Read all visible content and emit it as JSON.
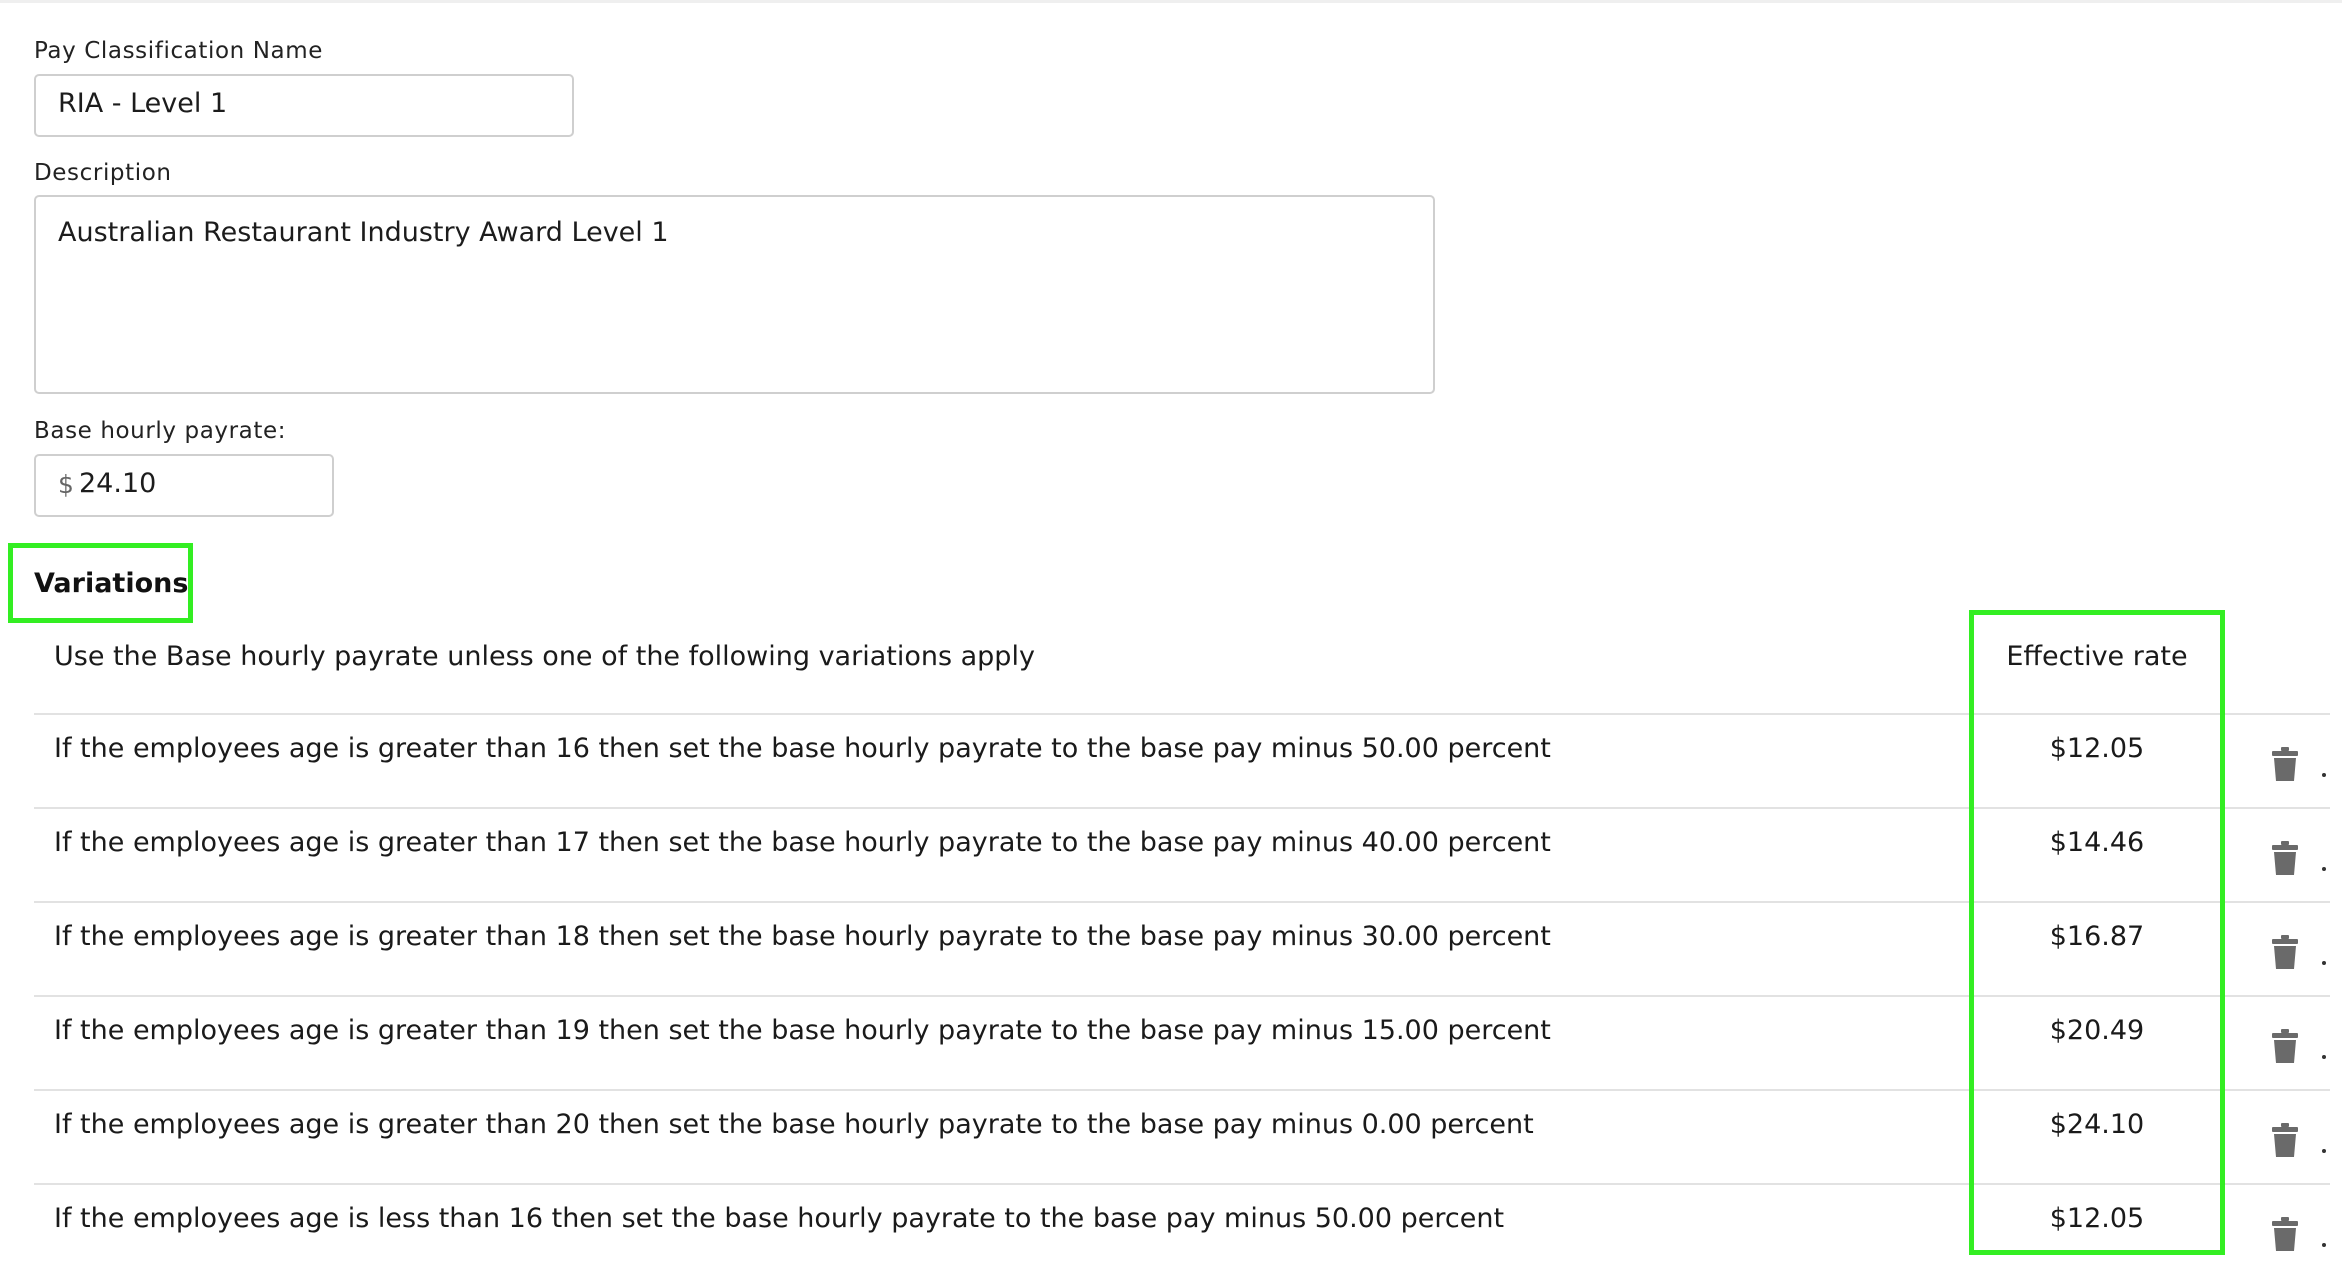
{
  "form": {
    "name_label": "Pay Classification Name",
    "name_value": "RIA - Level 1",
    "description_label": "Description",
    "description_value": "Australian Restaurant Industry Award Level 1",
    "base_rate_label": "Base hourly payrate:",
    "currency_symbol": "$",
    "base_rate_value": "24.10"
  },
  "variations": {
    "heading": "Variations",
    "intro": "Use the Base hourly payrate unless one of the following variations apply",
    "rate_header": "Effective rate",
    "highlight_color": "#33ee22",
    "rows": [
      {
        "text": "If the employees age is greater than 16 then set the base hourly payrate to the base pay minus 50.00 percent",
        "rate": "$12.05",
        "delete_icon": "trash-icon"
      },
      {
        "text": "If the employees age is greater than 17 then set the base hourly payrate to the base pay minus 40.00 percent",
        "rate": "$14.46",
        "delete_icon": "trash-icon"
      },
      {
        "text": "If the employees age is greater than 18 then set the base hourly payrate to the base pay minus 30.00 percent",
        "rate": "$16.87",
        "delete_icon": "trash-icon"
      },
      {
        "text": "If the employees age is greater than 19 then set the base hourly payrate to the base pay minus 15.00 percent",
        "rate": "$20.49",
        "delete_icon": "trash-icon"
      },
      {
        "text": "If the employees age is greater than 20 then set the base hourly payrate to the base pay minus 0.00 percent",
        "rate": "$24.10",
        "delete_icon": "trash-icon"
      },
      {
        "text": "If the employees age is less than 16 then set the base hourly payrate to the base pay minus 50.00 percent",
        "rate": "$12.05",
        "delete_icon": "trash-icon"
      }
    ]
  }
}
